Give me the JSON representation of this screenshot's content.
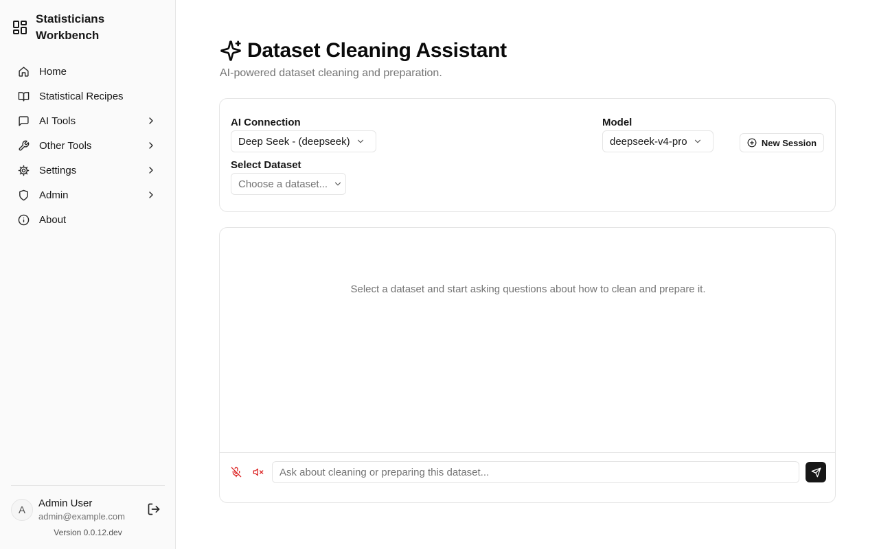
{
  "app": {
    "title": "Statisticians Workbench",
    "logo_icon": "layout-grid-icon"
  },
  "sidebar": {
    "items": [
      {
        "label": "Home",
        "icon": "home-icon",
        "expandable": false
      },
      {
        "label": "Statistical Recipes",
        "icon": "book-open-icon",
        "expandable": false
      },
      {
        "label": "AI Tools",
        "icon": "message-square-icon",
        "expandable": true
      },
      {
        "label": "Other Tools",
        "icon": "wrench-icon",
        "expandable": true
      },
      {
        "label": "Settings",
        "icon": "gear-icon",
        "expandable": true
      },
      {
        "label": "Admin",
        "icon": "shield-icon",
        "expandable": true
      },
      {
        "label": "About",
        "icon": "info-icon",
        "expandable": false
      }
    ]
  },
  "user": {
    "initial": "A",
    "name": "Admin User",
    "email": "admin@example.com",
    "version": "Version 0.0.12.dev"
  },
  "page": {
    "title": "Dataset Cleaning Assistant",
    "title_icon": "sparkles-icon",
    "subtitle": "AI-powered dataset cleaning and preparation."
  },
  "settings": {
    "connection_label": "AI Connection",
    "connection_value": "Deep Seek - (deepseek)",
    "model_label": "Model",
    "model_value": "deepseek-v4-pro",
    "dataset_label": "Select Dataset",
    "dataset_placeholder": "Choose a dataset...",
    "new_session_label": "New Session"
  },
  "chat": {
    "empty_message": "Select a dataset and start asking questions about how to clean and prepare it.",
    "input_placeholder": "Ask about cleaning or preparing this dataset...",
    "input_value": "",
    "status_color": "#dc2626"
  }
}
